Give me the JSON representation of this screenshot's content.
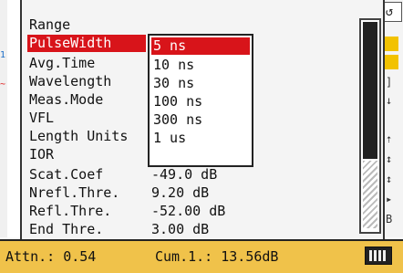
{
  "menu": {
    "items": [
      {
        "label": "Range"
      },
      {
        "label": "PulseWidth"
      },
      {
        "label": "Avg.Time"
      },
      {
        "label": "Wavelength"
      },
      {
        "label": "Meas.Mode"
      },
      {
        "label": "VFL"
      },
      {
        "label": "Length Units"
      },
      {
        "label": "IOR"
      },
      {
        "label": "Scat.Coef",
        "value": "-49.0 dB"
      },
      {
        "label": "Nrefl.Thre.",
        "value": "9.20 dB"
      },
      {
        "label": "Refl.Thre.",
        "value": "-52.00 dB"
      },
      {
        "label": "End Thre.",
        "value": "3.00 dB"
      }
    ],
    "selected_index": 1
  },
  "submenu": {
    "options": [
      "5 ns",
      "10 ns",
      "30 ns",
      "100 ns",
      "300 ns",
      "1 us"
    ],
    "selected_index": 0
  },
  "status": {
    "attn": "Attn.: 0.54",
    "cum": "Cum.1.: 13.56dB"
  },
  "background": {
    "top_left_fragment": "1",
    "left_marker": "1",
    "left_marker_2": "~"
  },
  "colors": {
    "selection": "#d8141a",
    "status_bar": "#f0c24a",
    "accent_yellow": "#f2c200"
  },
  "icons": [
    "scroll-up-icon",
    "cursor-icon",
    "marker-icon",
    "bracket-icon",
    "arrow-icon",
    "battery-icon"
  ]
}
